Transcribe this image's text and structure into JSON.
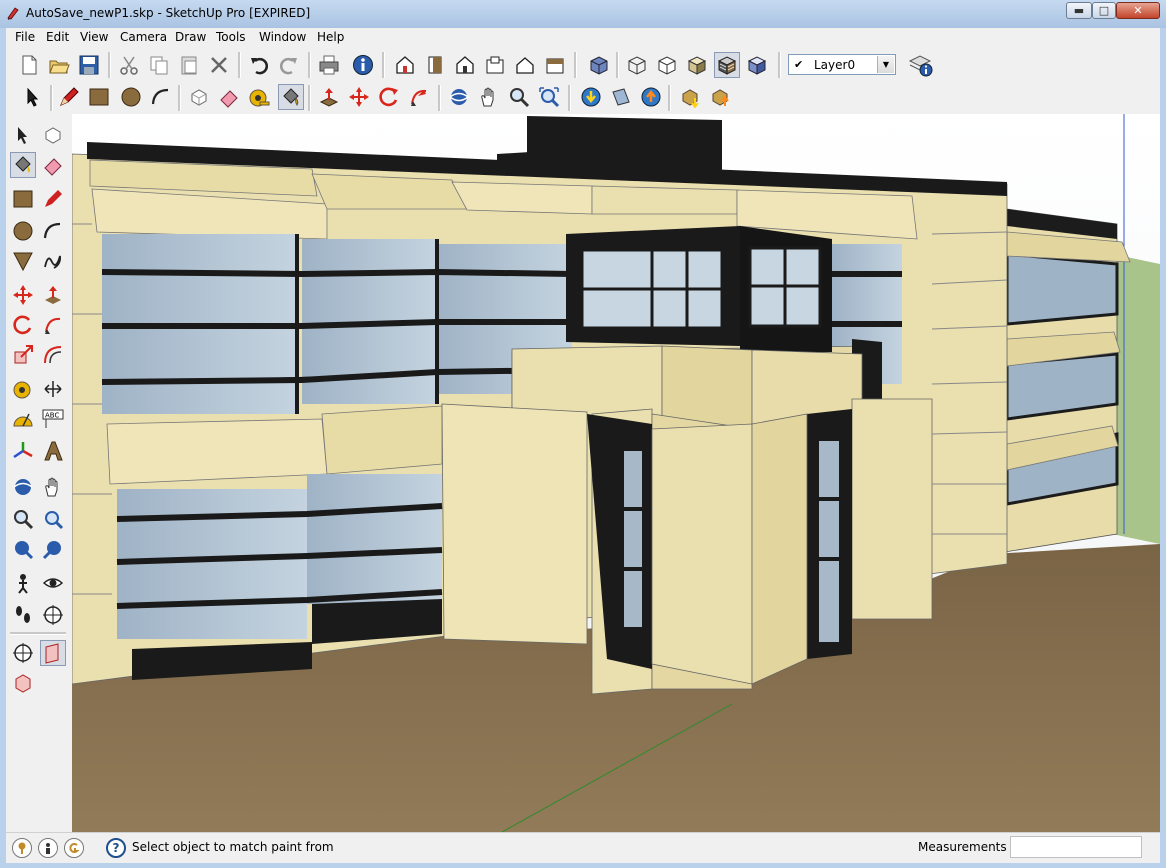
{
  "window": {
    "title": "AutoSave_newP1.skp - SketchUp Pro [EXPIRED]",
    "minimize_glyph": "▬",
    "maximize_glyph": "□",
    "close_glyph": "✕"
  },
  "menubar": {
    "items": [
      "File",
      "Edit",
      "View",
      "Camera",
      "Draw",
      "Tools",
      "Window",
      "Help"
    ]
  },
  "toolbar_top": {
    "buttons": [
      "new-icon",
      "open-icon",
      "save-icon",
      "cut-icon",
      "copy-icon",
      "paste-icon",
      "erase-icon",
      "undo-icon",
      "redo-icon",
      "print-icon",
      "model-info-icon",
      "iso-view-icon",
      "front-view-icon",
      "top-view-icon",
      "right-view-icon",
      "back-view-icon",
      "left-view-icon",
      "xray-icon",
      "wireframe-icon",
      "hidden-line-icon",
      "shaded-icon",
      "shaded-texture-icon",
      "monochrome-icon"
    ],
    "layer_selected": "Layer0",
    "layer_check": "✔",
    "layer_manager_icon": "layer-manager-icon"
  },
  "toolbar_second": {
    "buttons": [
      "select-icon",
      "pencil-icon",
      "rectangle-icon",
      "circle-icon",
      "arc-icon",
      "make-component-icon",
      "eraser-icon",
      "tape-measure-icon",
      "paint-bucket-icon",
      "push-pull-icon",
      "move-icon",
      "rotate-icon",
      "follow-me-icon",
      "orbit-icon",
      "pan-icon",
      "zoom-icon",
      "zoom-extents-icon",
      "get-models-icon",
      "share-model-icon",
      "share-component-icon",
      "get-photo-texture-icon",
      "dynamic-components-icon"
    ]
  },
  "left_toolbar": {
    "buttons": [
      "select-icon",
      "make-component-icon",
      "paint-bucket-icon",
      "eraser-icon",
      "rectangle-icon",
      "line-icon",
      "circle-icon",
      "arc-icon",
      "polygon-icon",
      "freehand-icon",
      "move-icon",
      "push-pull-icon",
      "rotate-icon",
      "follow-me-icon",
      "scale-icon",
      "offset-icon",
      "tape-measure-icon",
      "dimension-icon",
      "protractor-icon",
      "text-icon",
      "axes-icon",
      "3d-text-icon",
      "orbit-icon",
      "pan-icon",
      "zoom-icon",
      "zoom-window-icon",
      "previous-view-icon",
      "next-view-icon",
      "position-camera-icon",
      "look-around-icon",
      "walk-icon",
      "section-plane-icon",
      "display-section-icon",
      "section-cuts-icon",
      "section-fill-icon"
    ]
  },
  "status": {
    "text": "Select object to match paint from",
    "measurements_label": "Measurements",
    "measurements_value": "",
    "geo_icon": "geo-location-icon",
    "credits_icon": "credits-icon",
    "user_icon": "user-icon",
    "help_glyph": "?"
  },
  "colors": {
    "sky": "#ffffff",
    "ground": "#8a7350",
    "stone": "#eadfae",
    "glass": "#b5c7d6",
    "frame": "#1a1a1a",
    "chrome": "#f0f0f0"
  }
}
